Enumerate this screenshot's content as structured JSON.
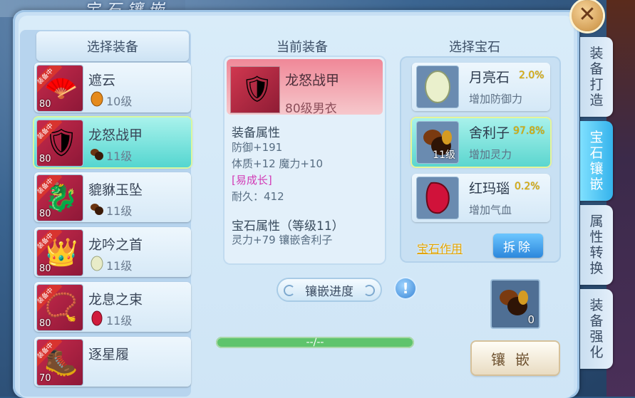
{
  "window": {
    "title": "宝石镶嵌"
  },
  "left": {
    "header": "选择装备",
    "items": [
      {
        "name": "遮云",
        "level": "80",
        "tag": "装备中",
        "gem_level": "10级",
        "icon": "fan-icon",
        "gem": "amber-gem"
      },
      {
        "name": "龙怒战甲",
        "level": "80",
        "tag": "装备中",
        "gem_level": "11级",
        "icon": "armor-icon",
        "gem": "relic-gem",
        "selected": true
      },
      {
        "name": "貔貅玉坠",
        "level": "80",
        "tag": "装备中",
        "gem_level": "11级",
        "icon": "jade-pendant-icon",
        "gem": "relic-gem"
      },
      {
        "name": "龙吟之首",
        "level": "80",
        "tag": "装备中",
        "gem_level": "11级",
        "icon": "helmet-icon",
        "gem": "moonstone-gem"
      },
      {
        "name": "龙息之束",
        "level": "80",
        "tag": "装备中",
        "gem_level": "11级",
        "icon": "belt-icon",
        "gem": "red-agate-gem"
      },
      {
        "name": "逐星履",
        "level": "70",
        "tag": "装备中",
        "icon": "boots-icon"
      }
    ]
  },
  "center": {
    "header": "当前装备",
    "equip_name": "龙怒战甲",
    "equip_sub": "80级男衣",
    "attr_title": "装备属性",
    "attrs": [
      "防御+191",
      "体质+12 魔力+10",
      "[易成长]",
      "耐久：412"
    ],
    "gem_attr_title": "宝石属性（等级11）",
    "gem_attr": "灵力+79 镶嵌舍利子",
    "progress_label": "镶嵌进度",
    "progress_text": "--/--",
    "progress_value": 0
  },
  "right": {
    "header": "选择宝石",
    "gems": [
      {
        "name": "月亮石",
        "pct": "2.0%",
        "desc": "增加防御力",
        "icon": "moonstone-icon"
      },
      {
        "name": "舍利子",
        "pct": "97.8%",
        "desc": "增加灵力",
        "count": "11级",
        "icon": "relic-icon",
        "selected": true
      },
      {
        "name": "红玛瑙",
        "pct": "0.2%",
        "desc": "增加气血",
        "icon": "red-agate-icon"
      }
    ],
    "effect_label": "宝石作用",
    "remove_label": "拆除",
    "slot_count": "0",
    "inlay_label": "镶嵌"
  },
  "tabs": [
    "装备打造",
    "宝石镶嵌",
    "属性转换",
    "装备强化"
  ],
  "colors": {
    "selected": "#5bd6cf",
    "tag": "#d8342f",
    "pct": "#e0b100",
    "pink": "#d23cb6"
  }
}
